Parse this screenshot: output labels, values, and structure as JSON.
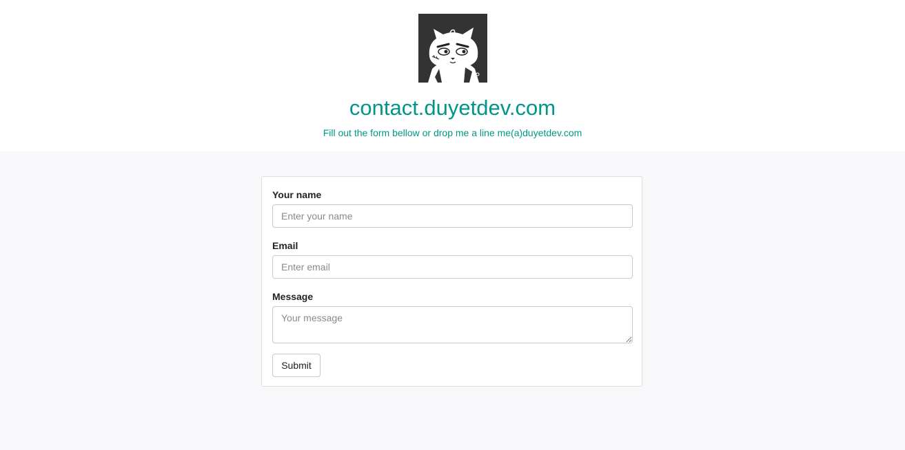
{
  "header": {
    "avatar_icon": "cat-mascot-icon",
    "title": "contact.duyetdev.com",
    "subtitle": "Fill out the form bellow or drop me a line me(a)duyetdev.com"
  },
  "form": {
    "name_label": "Your name",
    "name_placeholder": "Enter your name",
    "email_label": "Email",
    "email_placeholder": "Enter email",
    "message_label": "Message",
    "message_placeholder": "Your message",
    "submit_label": "Submit"
  },
  "colors": {
    "accent": "#009688",
    "page_background": "#f8f8fb",
    "avatar_background": "#333333"
  }
}
